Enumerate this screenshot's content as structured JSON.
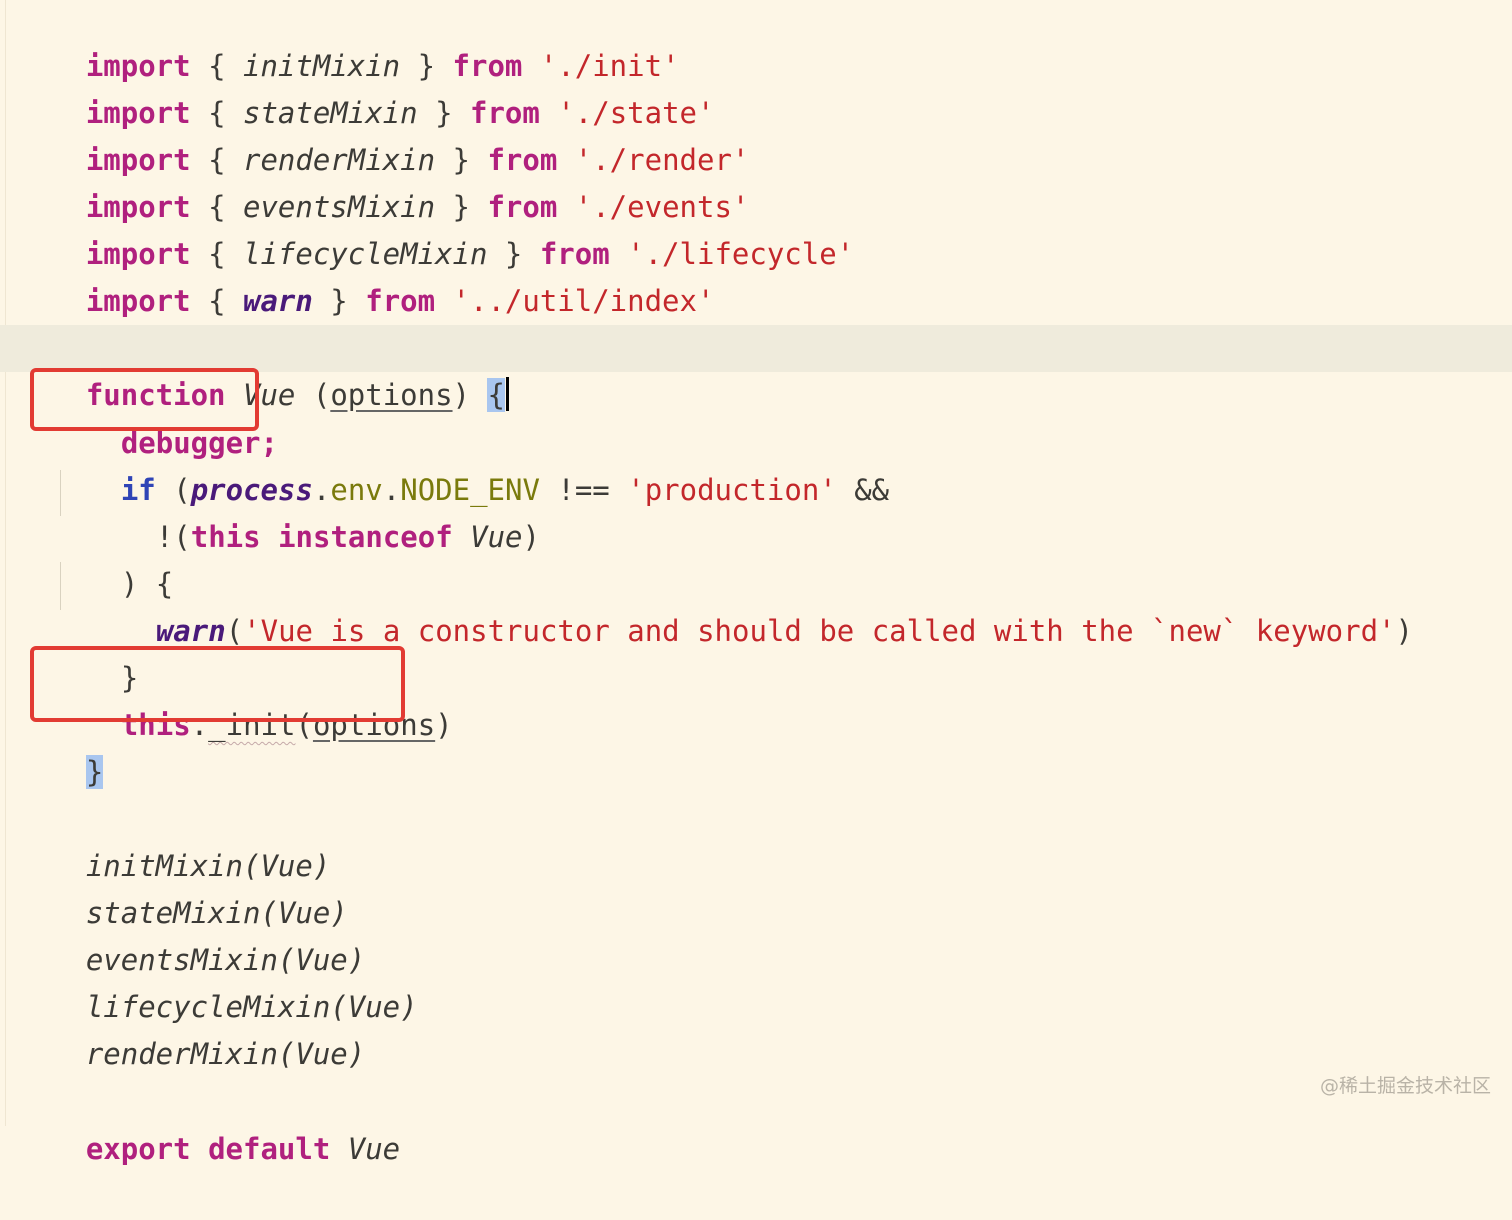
{
  "editor": {
    "imports": [
      {
        "kw": "import",
        "open": " { ",
        "name": "initMixin",
        "close": " } ",
        "from": "from",
        "path": "'./init'"
      },
      {
        "kw": "import",
        "open": " { ",
        "name": "stateMixin",
        "close": " } ",
        "from": "from",
        "path": "'./state'"
      },
      {
        "kw": "import",
        "open": " { ",
        "name": "renderMixin",
        "close": " } ",
        "from": "from",
        "path": "'./render'"
      },
      {
        "kw": "import",
        "open": " { ",
        "name": "eventsMixin",
        "close": " } ",
        "from": "from",
        "path": "'./events'"
      },
      {
        "kw": "import",
        "open": " { ",
        "name": "lifecycleMixin",
        "close": " } ",
        "from": "from",
        "path": "'./lifecycle'"
      },
      {
        "kw": "import",
        "open": " { ",
        "name": "warn",
        "close": " } ",
        "from": "from",
        "path": "'../util/index'"
      }
    ],
    "fn_decl": {
      "kw": "function",
      "name": "Vue",
      "paren_open": " (",
      "param": "options",
      "paren_close": ") ",
      "brace": "{"
    },
    "debugger_line": "debugger;",
    "if_line": {
      "kw": "if",
      "paren": " (",
      "obj": "process",
      "dot1": ".",
      "prop": "env",
      "dot2": ".",
      "const": "NODE_ENV",
      "op": " !== ",
      "str": "'production'",
      "and": " &&"
    },
    "cond_line": {
      "not": "!(",
      "this_kw": "this",
      "instanceof_kw": " instanceof ",
      "name": "Vue",
      "close": ")"
    },
    "close_paren_line": ") {",
    "warn_line": {
      "fn": "warn",
      "open": "(",
      "str": "'Vue is a constructor and should be called with the `new` keyword'",
      "close": ")"
    },
    "close_if": "}",
    "init_line": {
      "this_kw": "this",
      "dot": ".",
      "method": "_init",
      "open": "(",
      "param": "options",
      "close": ")"
    },
    "fn_close": "}",
    "mixin_calls": [
      {
        "name": "initMixin",
        "arg": "(Vue)"
      },
      {
        "name": "stateMixin",
        "arg": "(Vue)"
      },
      {
        "name": "eventsMixin",
        "arg": "(Vue)"
      },
      {
        "name": "lifecycleMixin",
        "arg": "(Vue)"
      },
      {
        "name": "renderMixin",
        "arg": "(Vue)"
      }
    ],
    "export_line": {
      "export_kw": "export",
      "default_kw": " default ",
      "name": "Vue"
    }
  },
  "colors": {
    "background": "#fdf6e6",
    "keyword": "#b0207e",
    "string": "#c3272b",
    "highlight_box": "#e23b33",
    "brace_match": "#a9c6ef"
  },
  "watermark": "@稀土掘金技术社区"
}
